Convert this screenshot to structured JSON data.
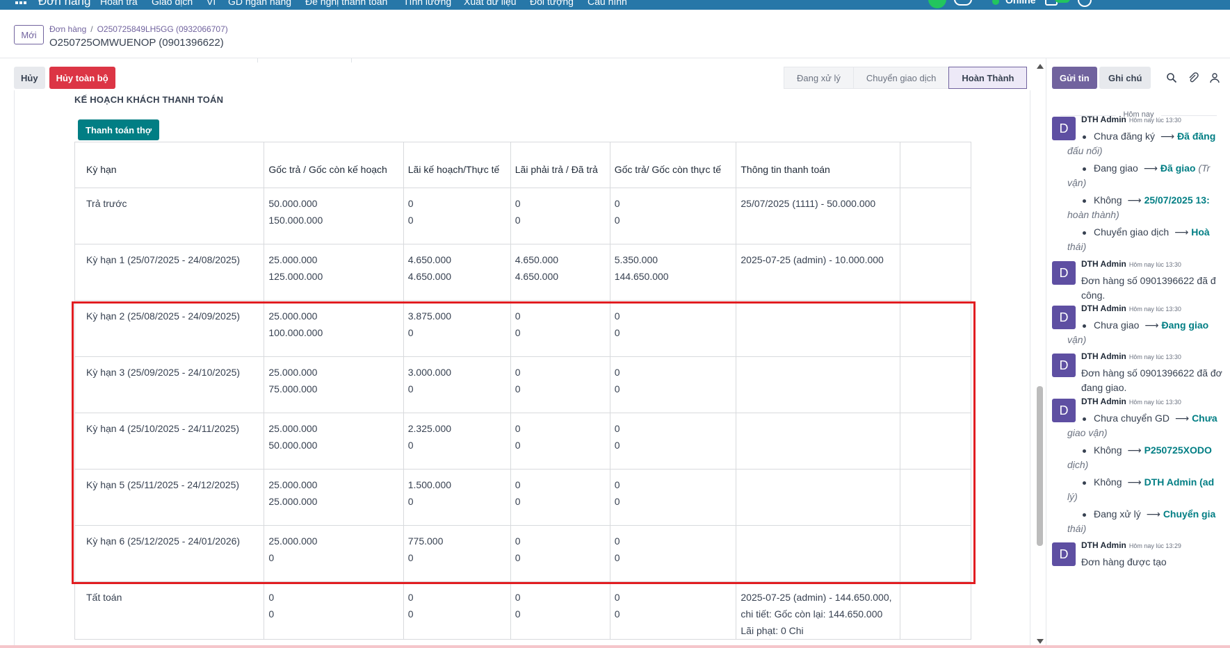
{
  "topbar": {
    "brand": "Đơn hàng",
    "menu": [
      "Hoàn trả",
      "Giao dịch",
      "Ví",
      "GD ngân hàng",
      "Đề nghị thanh toán",
      "Tính lương",
      "Xuất dữ liệu",
      "Đối tượng",
      "Cấu hình"
    ],
    "status": "Online"
  },
  "header": {
    "new_label": "Mới",
    "breadcrumb_root": "Đơn hàng",
    "breadcrumb_sep": "/",
    "breadcrumb_parent": "O250725849LH5GG (0932066707)",
    "record_title": "O250725OMWUENOP (0901396622)"
  },
  "actions": {
    "cancel": "Hủy",
    "cancel_all": "Hủy toàn bộ"
  },
  "status_steps": [
    {
      "label": "Đang xử lý",
      "active": false
    },
    {
      "label": "Chuyển giao dịch",
      "active": false
    },
    {
      "label": "Hoàn Thành",
      "active": true
    }
  ],
  "plan": {
    "title": "KẾ HOẠCH KHÁCH THANH TOÁN",
    "pay_button": "Thanh toán thợ",
    "columns": [
      "Kỳ hạn",
      "Gốc trả / Gốc còn kế hoạch",
      "Lãi kế hoạch/Thực tế",
      "Lãi phải trả / Đã trả",
      "Gốc trả/ Gốc còn thực tế",
      "Thông tin thanh toán",
      ""
    ],
    "rows": [
      {
        "term": "Trả trước",
        "principal": [
          "50.000.000",
          "150.000.000"
        ],
        "interest": [
          "0",
          "0"
        ],
        "due": [
          "0",
          "0"
        ],
        "actual": [
          "0",
          "0"
        ],
        "info": "25/07/2025 (1111) - 50.000.000"
      },
      {
        "term": "Kỳ hạn 1 (25/07/2025 - 24/08/2025)",
        "principal": [
          "25.000.000",
          "125.000.000"
        ],
        "interest": [
          "4.650.000",
          "4.650.000"
        ],
        "due": [
          "4.650.000",
          "4.650.000"
        ],
        "actual": [
          "5.350.000",
          "144.650.000"
        ],
        "info": "2025-07-25 (admin) - 10.000.000"
      },
      {
        "term": "Kỳ hạn 2 (25/08/2025 - 24/09/2025)",
        "principal": [
          "25.000.000",
          "100.000.000"
        ],
        "interest": [
          "3.875.000",
          "0"
        ],
        "due": [
          "0",
          "0"
        ],
        "actual": [
          "0",
          "0"
        ],
        "info": ""
      },
      {
        "term": "Kỳ hạn 3 (25/09/2025 - 24/10/2025)",
        "principal": [
          "25.000.000",
          "75.000.000"
        ],
        "interest": [
          "3.000.000",
          "0"
        ],
        "due": [
          "0",
          "0"
        ],
        "actual": [
          "0",
          "0"
        ],
        "info": ""
      },
      {
        "term": "Kỳ hạn 4 (25/10/2025 - 24/11/2025)",
        "principal": [
          "25.000.000",
          "50.000.000"
        ],
        "interest": [
          "2.325.000",
          "0"
        ],
        "due": [
          "0",
          "0"
        ],
        "actual": [
          "0",
          "0"
        ],
        "info": ""
      },
      {
        "term": "Kỳ hạn 5 (25/11/2025 - 24/12/2025)",
        "principal": [
          "25.000.000",
          "25.000.000"
        ],
        "interest": [
          "1.500.000",
          "0"
        ],
        "due": [
          "0",
          "0"
        ],
        "actual": [
          "0",
          "0"
        ],
        "info": ""
      },
      {
        "term": "Kỳ hạn 6 (25/12/2025 - 24/01/2026)",
        "principal": [
          "25.000.000",
          "0"
        ],
        "interest": [
          "775.000",
          "0"
        ],
        "due": [
          "0",
          "0"
        ],
        "actual": [
          "0",
          "0"
        ],
        "info": ""
      },
      {
        "term": "Tất toán",
        "principal": [
          "0",
          "0"
        ],
        "interest": [
          "0",
          "0"
        ],
        "due": [
          "0",
          "0"
        ],
        "actual": [
          "0",
          "0"
        ],
        "info": "2025-07-25 (admin) - 144.650.000, chi tiết: Gốc còn lại: 144.650.000 Lãi phạt: 0 Chi"
      }
    ]
  },
  "chat": {
    "send_label": "Gửi tin",
    "note_label": "Ghi chú",
    "today": "Hôm nay",
    "messages": [
      {
        "avatar": "D",
        "author": "DTH Admin",
        "time": "Hôm nay lúc 13:30",
        "changes": [
          {
            "old": "Chưa đăng ký",
            "new": "Đã đăng",
            "field": "đấu nối)"
          },
          {
            "old": "Đang giao",
            "new": "Đã giao",
            "field": "vận)",
            "new_suffix": "(Tr"
          },
          {
            "old": "Không",
            "new": "25/07/2025 13:",
            "field": "hoàn thành)"
          },
          {
            "old": "Chuyển giao dịch",
            "new": "Hoà",
            "field": "thái)"
          }
        ]
      },
      {
        "avatar": "D",
        "author": "DTH Admin",
        "time": "Hôm nay lúc 13:30",
        "text": [
          "Đơn hàng số 0901396622 đã đ",
          "công."
        ]
      },
      {
        "avatar": "D",
        "author": "DTH Admin",
        "time": "Hôm nay lúc 13:30",
        "changes": [
          {
            "old": "Chưa giao",
            "new": "Đang giao",
            "field": "vận)"
          }
        ]
      },
      {
        "avatar": "D",
        "author": "DTH Admin",
        "time": "Hôm nay lúc 13:30",
        "text": [
          "Đơn hàng số 0901396622 đã đơ",
          "đang giao."
        ]
      },
      {
        "avatar": "D",
        "author": "DTH Admin",
        "time": "Hôm nay lúc 13:30",
        "changes": [
          {
            "old": "Chưa chuyển GD",
            "new": "Chưa",
            "field": "giao vận)"
          },
          {
            "old": "Không",
            "new": "P250725XODO",
            "field": "dịch)"
          },
          {
            "old": "Không",
            "new": "DTH Admin (ad",
            "field": "lý)"
          },
          {
            "old": "Đang xử lý",
            "new": "Chuyển gia",
            "field": "thái)"
          }
        ]
      },
      {
        "avatar": "D",
        "author": "DTH Admin",
        "time": "Hôm nay lúc 13:29",
        "text": [
          "Đơn hàng được tạo"
        ]
      }
    ]
  },
  "colors": {
    "topbar": "#2777a8",
    "primary": "#71639e",
    "danger": "#dc3545",
    "teal": "#017e84",
    "highlight": "#e11d21"
  }
}
